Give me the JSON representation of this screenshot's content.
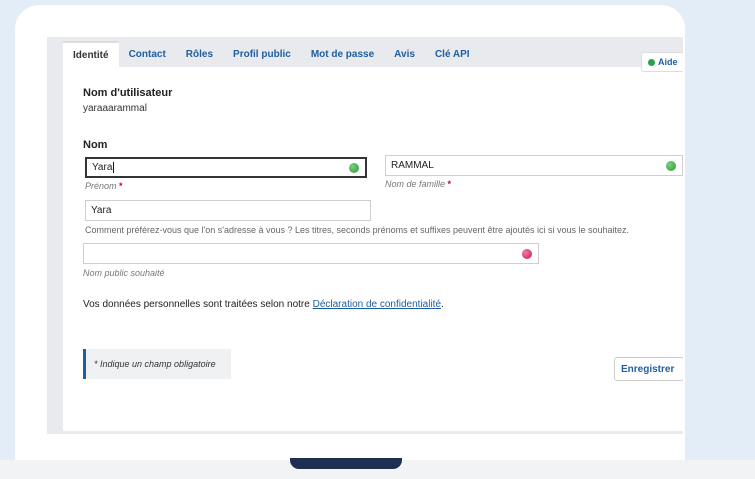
{
  "tabs": [
    "Identité",
    "Contact",
    "Rôles",
    "Profil public",
    "Mot de passe",
    "Avis",
    "Clé API"
  ],
  "help_label": "Aide",
  "username": {
    "label": "Nom d'utilisateur",
    "value": "yaraaarammal"
  },
  "name": {
    "label": "Nom",
    "given_value": "Yara",
    "given_hint": "Prénom",
    "family_value": "RAMMAL",
    "family_hint": "Nom de famille",
    "required_mark": "*"
  },
  "preferred": {
    "value": "Yara",
    "description": "Comment préférez-vous que l'on s'adresse à vous ? Les titres, seconds prénoms et suffixes peuvent être ajoutés ici si vous le souhaitez."
  },
  "public_name": {
    "value": "",
    "hint": "Nom public souhaité"
  },
  "privacy": {
    "text": "Vos données personnelles sont traitées selon notre",
    "link": "Déclaration de confidentialité",
    "end": "."
  },
  "required_note": "* Indique un champ obligatoire",
  "save_label": "Enregistrer"
}
